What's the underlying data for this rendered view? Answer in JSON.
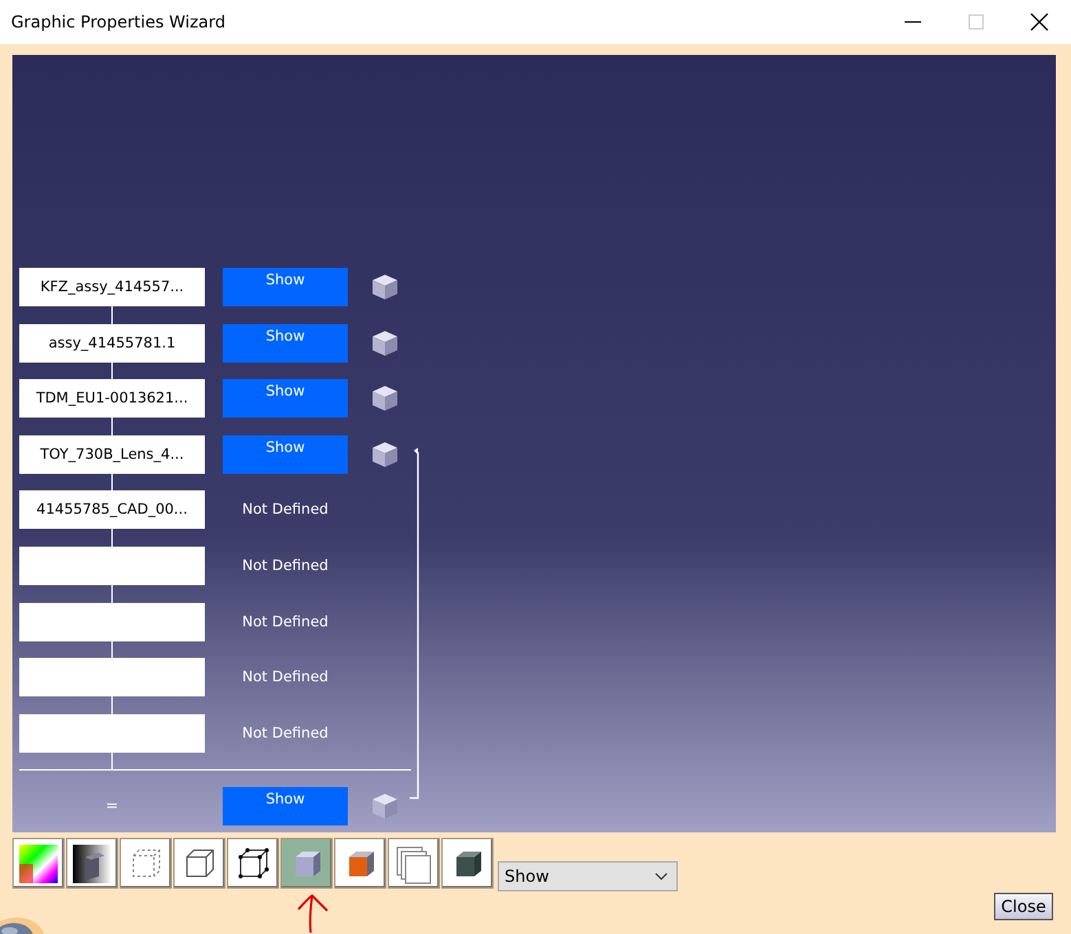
{
  "window": {
    "title": "Graphic Properties Wizard"
  },
  "rows": [
    {
      "name": "KFZ_assy_414557...",
      "kind": "show",
      "value": "Show"
    },
    {
      "name": "assy_41455781.1",
      "kind": "show",
      "value": "Show"
    },
    {
      "name": "TDM_EU1-0013621...",
      "kind": "show",
      "value": "Show"
    },
    {
      "name": "TOY_730B_Lens_4...",
      "kind": "show",
      "value": "Show"
    },
    {
      "name": "41455785_CAD_00...",
      "kind": "undefined",
      "value": "Not Defined"
    },
    {
      "name": "",
      "kind": "undefined",
      "value": "Not Defined"
    },
    {
      "name": "",
      "kind": "undefined",
      "value": "Not Defined"
    },
    {
      "name": "",
      "kind": "undefined",
      "value": "Not Defined"
    },
    {
      "name": "",
      "kind": "undefined",
      "value": "Not Defined"
    }
  ],
  "summary": {
    "label": "=",
    "value": "Show"
  },
  "toolbar": [
    {
      "selected": false
    },
    {
      "selected": false
    },
    {
      "selected": false
    },
    {
      "selected": false
    },
    {
      "selected": false
    },
    {
      "selected": true
    },
    {
      "selected": false
    },
    {
      "selected": false
    },
    {
      "selected": false
    }
  ],
  "dropdown": {
    "value": "Show"
  },
  "close_button": "Close"
}
